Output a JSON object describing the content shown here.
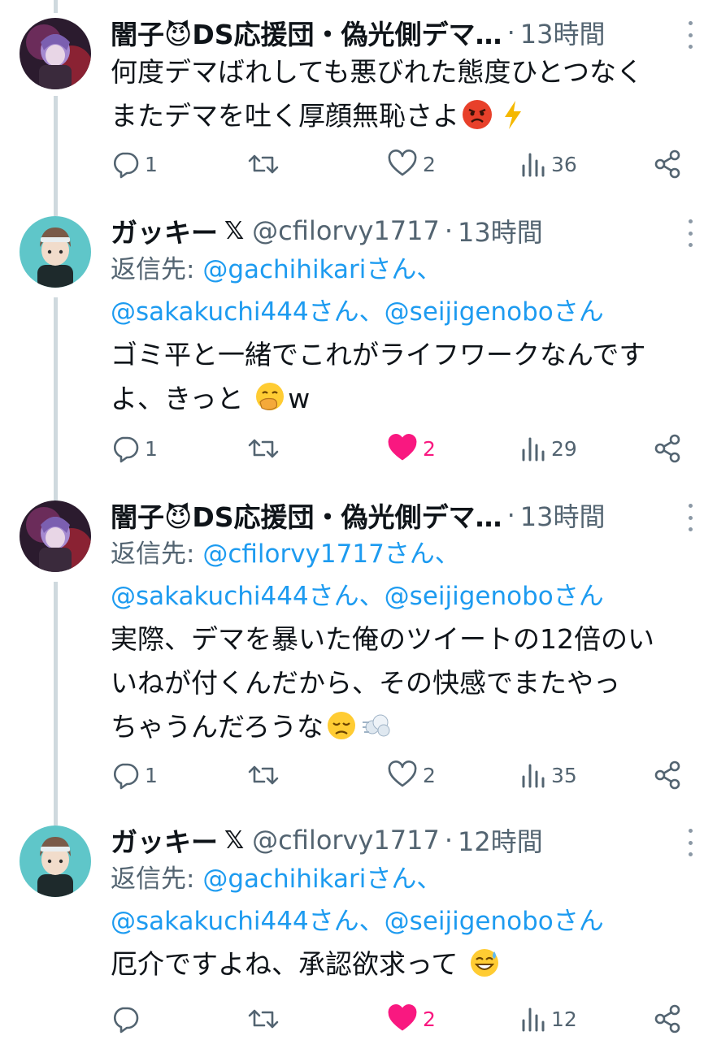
{
  "tweets": [
    {
      "name": "闇子😈DS応援団・偽光側デマ…",
      "verified_x": "",
      "handle": "",
      "separator": "·",
      "time": "13時間",
      "reply_to_label": "",
      "reply_to_line1": [],
      "reply_to_line2": [],
      "lines": [
        "何度デマばれしても悪びれた態度ひとつなく",
        "またデマを吐く厚顔無恥さよ"
      ],
      "replies": "1",
      "retweets": "",
      "likes": "2",
      "liked": false,
      "views": "36"
    },
    {
      "name": "ガッキー",
      "verified_x": "𝕏",
      "handle": "@cfilorvy1717",
      "separator": "·",
      "time": "13時間",
      "reply_to_label": "返信先: ",
      "reply_to_line1": [
        "@gachihikariさん、"
      ],
      "reply_to_line2": [
        "@sakakuchi444さん、",
        "@seijigenoboさん"
      ],
      "lines": [
        "ゴミ平と一緒でこれがライフワークなんです",
        "よ、きっと"
      ],
      "line_suffix": "w",
      "replies": "1",
      "retweets": "",
      "likes": "2",
      "liked": true,
      "views": "29"
    },
    {
      "name": "闇子😈DS応援団・偽光側デマ…",
      "verified_x": "",
      "handle": "",
      "separator": "·",
      "time": "13時間",
      "reply_to_label": "返信先: ",
      "reply_to_line1": [
        "@cfilorvy1717さん、"
      ],
      "reply_to_line2": [
        "@sakakuchi444さん、",
        "@seijigenoboさん"
      ],
      "lines": [
        "実際、デマを暴いた俺のツイートの12倍のい",
        "いねが付くんだから、その快感でまたやっ",
        "ちゃうんだろうな"
      ],
      "replies": "1",
      "retweets": "",
      "likes": "2",
      "liked": false,
      "views": "35"
    },
    {
      "name": "ガッキー",
      "verified_x": "𝕏",
      "handle": "@cfilorvy1717",
      "separator": "·",
      "time": "12時間",
      "reply_to_label": "返信先: ",
      "reply_to_line1": [
        "@gachihikariさん、"
      ],
      "reply_to_line2": [
        "@sakakuchi444さん、",
        "@seijigenoboさん"
      ],
      "lines": [
        "厄介ですよね、承認欲求って"
      ],
      "replies": "",
      "retweets": "",
      "likes": "2",
      "liked": true,
      "views": "12"
    }
  ],
  "icons": {
    "reply": "reply-icon",
    "retweet": "retweet-icon",
    "like": "heart-icon",
    "views": "views-icon",
    "share": "share-icon",
    "more": "more-icon"
  },
  "colors": {
    "accent": "#1d9bf0",
    "like": "#f91880",
    "muted": "#536471",
    "thread": "#cfd9de"
  }
}
